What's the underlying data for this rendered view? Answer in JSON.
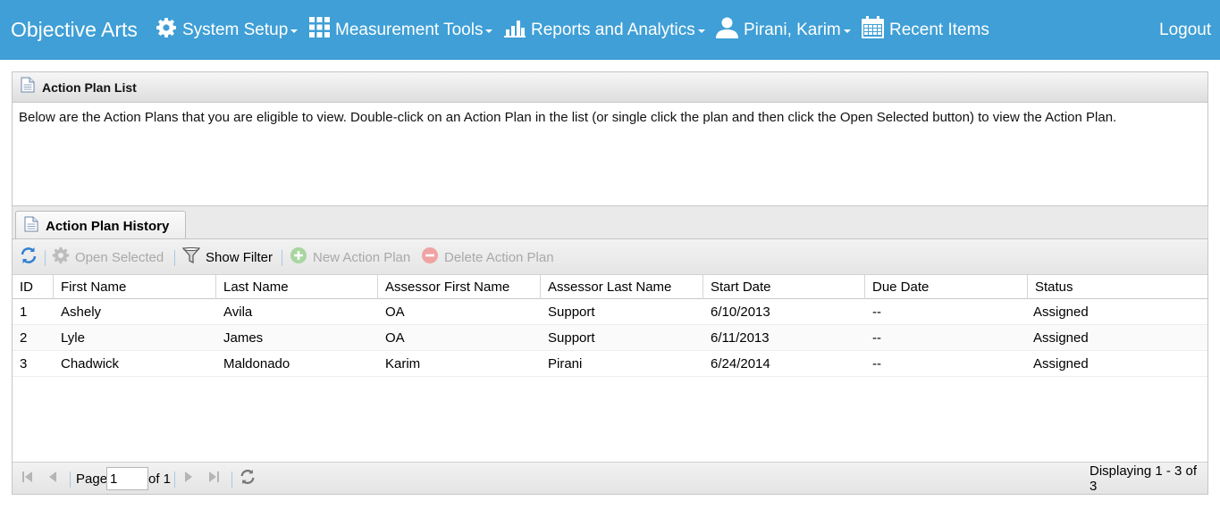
{
  "nav": {
    "brand": "Objective Arts",
    "items": [
      {
        "label": "System Setup",
        "icon": "gear-icon"
      },
      {
        "label": "Measurement Tools",
        "icon": "grid-icon"
      },
      {
        "label": "Reports and Analytics",
        "icon": "bar-chart-icon"
      },
      {
        "label": "Pirani, Karim",
        "icon": "user-icon"
      },
      {
        "label": "Recent Items",
        "icon": "calendar-icon"
      }
    ],
    "logout": "Logout",
    "bg_color": "#3f9fd6"
  },
  "list_panel": {
    "title": "Action Plan List",
    "description": "Below are the Action Plans that you are eligible to view. Double-click on an Action Plan in the list (or single click the plan and then click the Open Selected button) to view the Action Plan."
  },
  "tab": {
    "title": "Action Plan History"
  },
  "toolbar": {
    "open_selected": "Open Selected",
    "show_filter": "Show Filter",
    "new_action_plan": "New Action Plan",
    "delete_action_plan": "Delete Action Plan"
  },
  "table": {
    "columns": [
      "ID",
      "First Name",
      "Last Name",
      "Assessor First Name",
      "Assessor Last Name",
      "Start Date",
      "Due Date",
      "Status"
    ],
    "rows": [
      [
        "1",
        "Ashely",
        "Avila",
        "OA",
        "Support",
        "6/10/2013",
        "--",
        "Assigned"
      ],
      [
        "2",
        "Lyle",
        "James",
        "OA",
        "Support",
        "6/11/2013",
        "--",
        "Assigned"
      ],
      [
        "3",
        "Chadwick",
        "Maldonado",
        "Karim",
        "Pirani",
        "6/24/2014",
        "--",
        "Assigned"
      ]
    ]
  },
  "pager": {
    "page_label": "Page",
    "page_value": "1",
    "of_label": "of 1",
    "displaying": "Displaying 1 - 3 of 3"
  }
}
